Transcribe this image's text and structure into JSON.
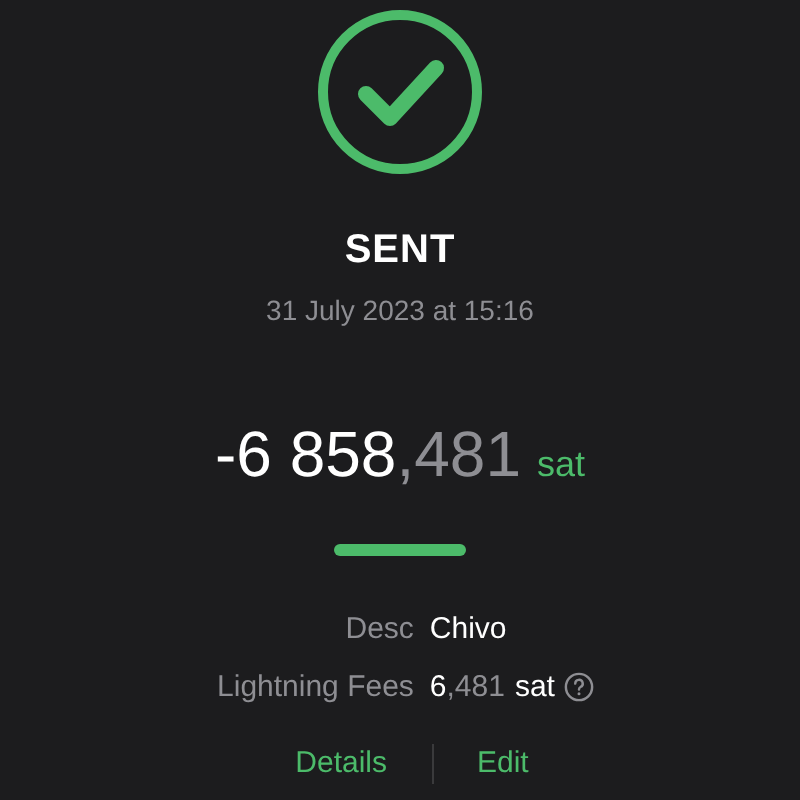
{
  "status": {
    "kind": "success",
    "title": "SENT",
    "date": "31 July 2023 at 15:16"
  },
  "amount": {
    "whole": "-6 858",
    "fraction": ",481",
    "unit": "sat"
  },
  "details": [
    {
      "label": "Desc",
      "value": "Chivo"
    },
    {
      "label": "Lightning Fees",
      "whole": "6",
      "fraction": ",481",
      "unit": "sat",
      "help": true
    }
  ],
  "actions": [
    "Details",
    "Edit"
  ]
}
